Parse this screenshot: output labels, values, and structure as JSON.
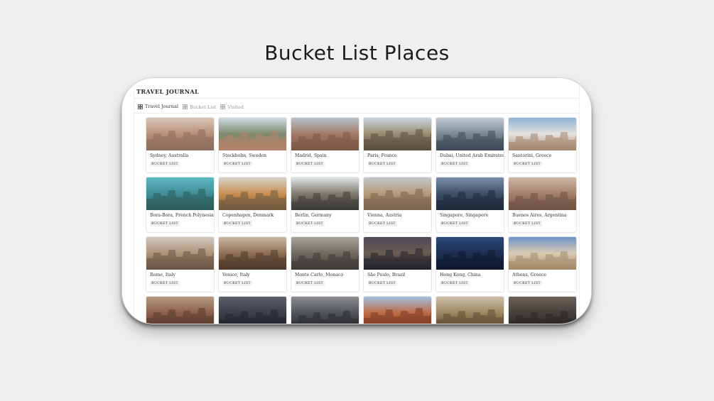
{
  "page_title": "Bucket List Places",
  "journal": {
    "heading": "TRAVEL JOURNAL",
    "tabs": [
      {
        "label": "Travel Journal",
        "icon": "gallery-icon",
        "active": true
      },
      {
        "label": "Bucket List",
        "icon": "gallery-icon",
        "active": false
      },
      {
        "label": "Visited",
        "icon": "gallery-icon",
        "active": false
      }
    ]
  },
  "places": [
    {
      "name": "Sydney, Australia",
      "tag": "BUCKET LIST",
      "colors": [
        "#d8c7b6",
        "#b98f79",
        "#8c6d5c"
      ]
    },
    {
      "name": "Stockholm, Sweden",
      "tag": "BUCKET LIST",
      "colors": [
        "#cfd9e3",
        "#7d8a6e",
        "#b4836a"
      ]
    },
    {
      "name": "Madrid, Spain",
      "tag": "BUCKET LIST",
      "colors": [
        "#b7c2cf",
        "#a17a66",
        "#7b5746"
      ]
    },
    {
      "name": "Paris, France",
      "tag": "BUCKET LIST",
      "colors": [
        "#c9d4df",
        "#9a8b70",
        "#5b4e3d"
      ]
    },
    {
      "name": "Dubai, United Arab Emirates",
      "tag": "BUCKET LIST",
      "colors": [
        "#c3cbd3",
        "#7a8894",
        "#3e4a57"
      ]
    },
    {
      "name": "Santorini, Greece",
      "tag": "BUCKET LIST",
      "colors": [
        "#8fb2d6",
        "#e6e2dc",
        "#a3856e"
      ]
    },
    {
      "name": "Bora-Bora, French Polynesia",
      "tag": "BUCKET LIST",
      "colors": [
        "#5fb9c1",
        "#3f8e98",
        "#2b5d5a"
      ]
    },
    {
      "name": "Copenhagen, Denmark",
      "tag": "BUCKET LIST",
      "colors": [
        "#d6d3cb",
        "#c98e4f",
        "#6f5a3f"
      ]
    },
    {
      "name": "Berlin, Germany",
      "tag": "BUCKET LIST",
      "colors": [
        "#dfe3e6",
        "#7e7a6f",
        "#3e3c38"
      ]
    },
    {
      "name": "Vienna, Austria",
      "tag": "BUCKET LIST",
      "colors": [
        "#c2c7c9",
        "#b49a78",
        "#7b6550"
      ]
    },
    {
      "name": "Singapore, Singapore",
      "tag": "BUCKET LIST",
      "colors": [
        "#7a8fa8",
        "#3e5068",
        "#1f2a3a"
      ]
    },
    {
      "name": "Buenos Aires, Argentina",
      "tag": "BUCKET LIST",
      "colors": [
        "#cdb8a6",
        "#a4806b",
        "#6d5243"
      ]
    },
    {
      "name": "Rome, Italy",
      "tag": "BUCKET LIST",
      "colors": [
        "#d1c8bd",
        "#ae9478",
        "#6a5646"
      ]
    },
    {
      "name": "Venice, Italy",
      "tag": "BUCKET LIST",
      "colors": [
        "#c9b8a3",
        "#8e6e53",
        "#4e3a2b"
      ]
    },
    {
      "name": "Monte Carlo, Monaco",
      "tag": "BUCKET LIST",
      "colors": [
        "#a8a49b",
        "#6f6a62",
        "#3f3b36"
      ]
    },
    {
      "name": "São Paulo, Brazil",
      "tag": "BUCKET LIST",
      "colors": [
        "#4a4a54",
        "#6b5d55",
        "#22222a"
      ]
    },
    {
      "name": "Hong Kong, China",
      "tag": "BUCKET LIST",
      "colors": [
        "#2c4a7a",
        "#1d2f52",
        "#0f1a30"
      ]
    },
    {
      "name": "Athens, Greece",
      "tag": "BUCKET LIST",
      "colors": [
        "#6d93c4",
        "#d9cbb4",
        "#a48a69"
      ]
    },
    {
      "name": "",
      "tag": "",
      "colors": [
        "#b49b82",
        "#8c5f4a",
        "#5b3d30"
      ]
    },
    {
      "name": "",
      "tag": "",
      "colors": [
        "#5a5f68",
        "#3b4048",
        "#23262c"
      ]
    },
    {
      "name": "",
      "tag": "",
      "colors": [
        "#8a8c8f",
        "#505357",
        "#2b2d30"
      ]
    },
    {
      "name": "",
      "tag": "",
      "colors": [
        "#9ec0df",
        "#c06a45",
        "#7a3b24"
      ]
    },
    {
      "name": "",
      "tag": "",
      "colors": [
        "#cbbfa8",
        "#9c8660",
        "#5e4c35"
      ]
    },
    {
      "name": "",
      "tag": "",
      "colors": [
        "#6b625a",
        "#45403b",
        "#2a2622"
      ]
    }
  ]
}
